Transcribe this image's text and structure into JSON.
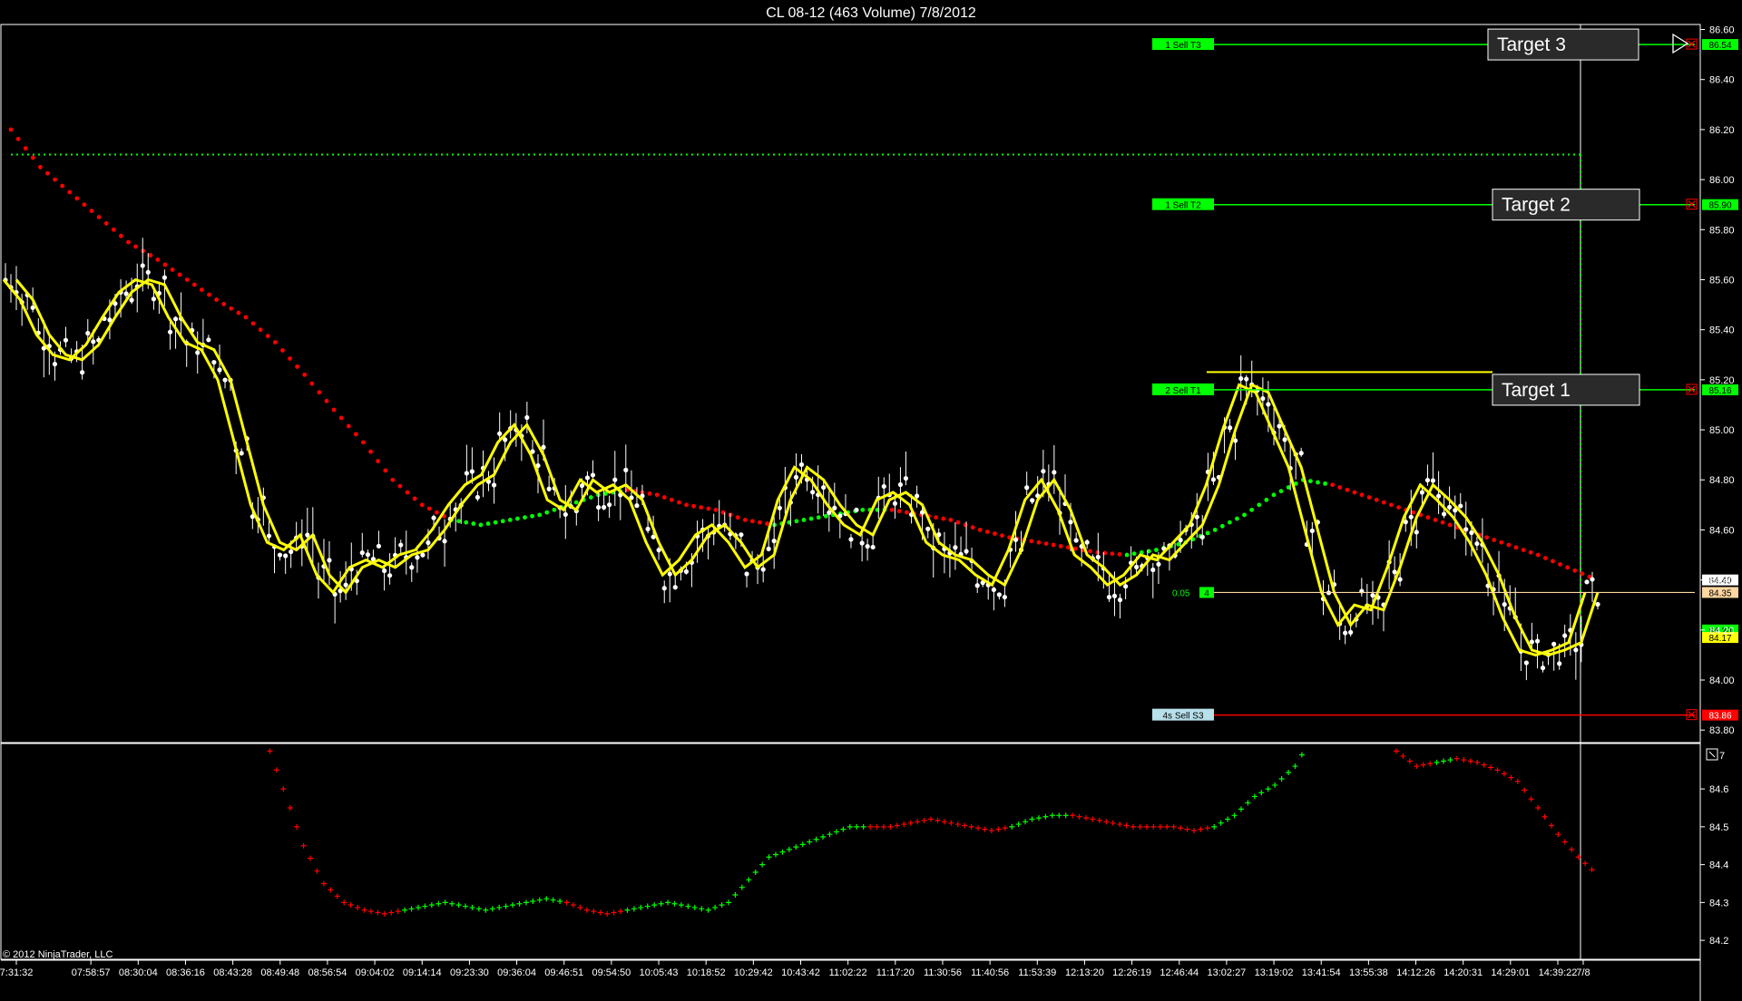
{
  "window": {
    "title": "CL 08-12 (463 Volume)  7/8/2012",
    "copyright": "© 2012 NinjaTrader, LLC",
    "subpanel_label": "7"
  },
  "colors": {
    "background": "#000000",
    "grid_border": "#ffffff",
    "price_candles": "#ffffff",
    "bands": "#ffff00",
    "band_inner": "#ffef00",
    "trend_up": "#00ff00",
    "trend_down": "#ff0000",
    "target_line": "#00ff00",
    "stop_line": "#ff0000",
    "entry_line": "#ffd7a0",
    "dotted_target": "#00ff00"
  },
  "chart_data": [
    {
      "type": "line",
      "title": "CL 08-12 (463 Volume)  7/8/2012",
      "xlabel": "",
      "ylabel": "",
      "ylim": [
        83.75,
        86.62
      ],
      "y_ticks": [
        86.6,
        86.4,
        86.2,
        86.0,
        85.8,
        85.6,
        85.4,
        85.2,
        85.0,
        84.8,
        84.6,
        84.4,
        84.2,
        84.0,
        83.8
      ],
      "x_ticks": [
        "7:31:32",
        "07:58:57",
        "08:30:04",
        "08:36:16",
        "08:43:28",
        "08:49:48",
        "08:56:54",
        "09:04:02",
        "09:14:14",
        "09:23:30",
        "09:36:04",
        "09:46:51",
        "09:54:50",
        "10:05:43",
        "10:18:52",
        "10:29:42",
        "10:43:42",
        "11:02:22",
        "11:17:20",
        "11:30:56",
        "11:40:56",
        "11:53:39",
        "12:13:20",
        "12:26:19",
        "12:46:44",
        "13:02:27",
        "13:19:02",
        "13:41:54",
        "13:55:38",
        "14:12:26",
        "14:20:31",
        "14:29:01",
        "14:39:22",
        "7/8"
      ],
      "series": [
        {
          "kind": "price",
          "values": [
            85.6,
            85.52,
            85.38,
            85.3,
            85.28,
            85.34,
            85.45,
            85.55,
            85.6,
            85.58,
            85.45,
            85.35,
            85.32,
            85.2,
            84.95,
            84.7,
            84.55,
            84.52,
            84.58,
            84.42,
            84.35,
            84.45,
            84.48,
            84.45,
            84.5,
            84.52,
            84.6,
            84.7,
            84.78,
            84.82,
            84.95,
            85.02,
            84.9,
            84.72,
            84.68,
            84.8,
            84.75,
            84.78,
            84.72,
            84.55,
            84.42,
            84.48,
            84.58,
            84.62,
            84.55,
            84.45,
            84.5,
            84.72,
            84.85,
            84.8,
            84.7,
            84.62,
            84.58,
            84.72,
            84.75,
            84.7,
            84.55,
            84.5,
            84.48,
            84.42,
            84.38,
            84.52,
            84.72,
            84.8,
            84.68,
            84.5,
            84.45,
            84.38,
            84.42,
            84.5,
            84.48,
            84.55,
            84.62,
            84.78,
            85.0,
            85.18,
            85.15,
            85.0,
            84.85,
            84.6,
            84.35,
            84.22,
            84.3,
            84.28,
            84.45,
            84.65,
            84.78,
            84.72,
            84.65,
            84.55,
            84.42,
            84.25,
            84.12,
            84.1,
            84.12,
            84.15,
            84.35
          ]
        },
        {
          "kind": "trend_dots",
          "values": [
            86.2,
            86.05,
            85.95,
            85.85,
            85.75,
            85.68,
            85.6,
            85.52,
            85.45,
            85.35,
            85.22,
            85.08,
            84.95,
            84.8,
            84.7,
            84.64,
            84.62,
            84.64,
            84.66,
            84.7,
            84.74,
            84.76,
            84.74,
            84.7,
            84.68,
            84.64,
            84.62,
            84.64,
            84.66,
            84.68,
            84.68,
            84.66,
            84.64,
            84.6,
            84.57,
            84.55,
            84.53,
            84.51,
            84.5,
            84.52,
            84.55,
            84.6,
            84.66,
            84.74,
            84.8,
            84.78,
            84.74,
            84.7,
            84.66,
            84.62,
            84.58,
            84.54,
            84.5,
            84.45,
            84.4
          ],
          "colors": [
            "d",
            "d",
            "d",
            "d",
            "d",
            "d",
            "d",
            "d",
            "d",
            "d",
            "d",
            "d",
            "d",
            "d",
            "d",
            "u",
            "u",
            "u",
            "u",
            "u",
            "u",
            "d",
            "d",
            "d",
            "d",
            "d",
            "u",
            "u",
            "u",
            "u",
            "d",
            "d",
            "d",
            "d",
            "d",
            "d",
            "d",
            "d",
            "u",
            "u",
            "u",
            "u",
            "u",
            "u",
            "u",
            "d",
            "d",
            "d",
            "d",
            "d",
            "d",
            "d",
            "d",
            "d",
            "d"
          ]
        }
      ],
      "orders": [
        {
          "tag": "1   Sell T3",
          "price": 86.54,
          "label": "86.54",
          "box": "Target 3"
        },
        {
          "tag": "1   Sell T2",
          "price": 85.9,
          "label": "85.90",
          "box": "Target 2"
        },
        {
          "tag": "2   Sell T1",
          "price": 85.16,
          "label": "85.16",
          "box": "Target 1"
        },
        {
          "tag": "4s   Sell S3",
          "price": 83.86,
          "label": "83.86",
          "box": ""
        }
      ],
      "entry": {
        "price": 84.35,
        "label": "84.35",
        "qty_text": "0.05",
        "qty_badge": "4"
      },
      "dotted_target": 86.1,
      "last_price_labels": [
        {
          "price": 84.4,
          "label": "84.40"
        },
        {
          "price": 84.2,
          "label": "84.20"
        },
        {
          "price": 84.17,
          "label": "84.17"
        }
      ]
    },
    {
      "type": "line",
      "title": "",
      "ylim": [
        84.15,
        84.72
      ],
      "y_ticks": [
        84.6,
        84.5,
        84.4,
        84.3,
        84.2
      ],
      "series": [
        {
          "kind": "trend_plus",
          "values": [
            84.75,
            84.6,
            84.45,
            84.35,
            84.3,
            84.28,
            84.27,
            84.28,
            84.29,
            84.3,
            84.29,
            84.28,
            84.29,
            84.3,
            84.31,
            84.3,
            84.28,
            84.27,
            84.28,
            84.29,
            84.3,
            84.29,
            84.28,
            84.3,
            84.36,
            84.42,
            84.44,
            84.46,
            84.48,
            84.5,
            84.5,
            84.5,
            84.51,
            84.52,
            84.51,
            84.5,
            84.49,
            84.5,
            84.52,
            84.53,
            84.53,
            84.52,
            84.51,
            84.5,
            84.5,
            84.5,
            84.49,
            84.5,
            84.53,
            84.58,
            84.61,
            84.66,
            84.75,
            84.8,
            84.85,
            84.8,
            84.7,
            84.66,
            84.67,
            84.68,
            84.67,
            84.65,
            84.62,
            84.55,
            84.48,
            84.42,
            84.37
          ],
          "colors": [
            "d",
            "d",
            "d",
            "d",
            "d",
            "d",
            "d",
            "u",
            "u",
            "u",
            "u",
            "u",
            "u",
            "u",
            "u",
            "d",
            "d",
            "d",
            "u",
            "u",
            "u",
            "u",
            "u",
            "u",
            "u",
            "u",
            "u",
            "u",
            "u",
            "u",
            "d",
            "d",
            "d",
            "d",
            "d",
            "d",
            "d",
            "u",
            "u",
            "u",
            "d",
            "d",
            "d",
            "d",
            "d",
            "d",
            "d",
            "u",
            "u",
            "u",
            "u",
            "u",
            "u",
            "u",
            "u",
            "d",
            "d",
            "d",
            "u",
            "d",
            "d",
            "d",
            "d",
            "d",
            "d",
            "d",
            "d"
          ]
        }
      ]
    }
  ]
}
